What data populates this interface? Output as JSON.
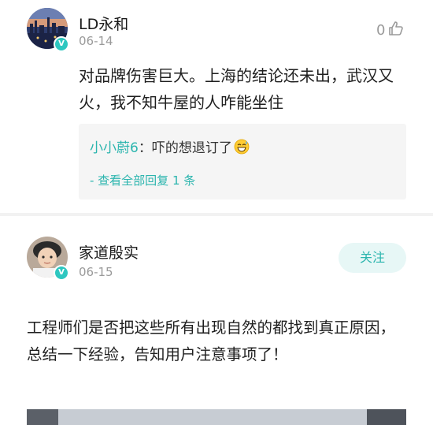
{
  "comments": [
    {
      "username": "LD永和",
      "date": "06-14",
      "verified_badge": "V",
      "text": "对品牌伤害巨大。上海的结论还未出，武汉又火，我不知牛屋的人咋能坐住",
      "likes": "0",
      "reply": {
        "author": "小小蔚6",
        "separator": "：",
        "text": "吓的想退订了",
        "emoji_icon": "grinning-sweat-emoji",
        "view_all": "- 查看全部回复 1 条"
      }
    },
    {
      "username": "家道殷实",
      "date": "06-15",
      "verified_badge": "V",
      "follow_label": "关注",
      "text": "工程师们是否把这些所有出现自然的都找到真正原因，总结一下经验，告知用户注意事项了！"
    }
  ],
  "colors": {
    "accent": "#2bb5ae",
    "badge": "#2ec7c0",
    "follow_bg": "#e7f7f6",
    "reply_bg": "#f5f5f5",
    "meta": "#9a9a9a"
  },
  "icons": {
    "like": "thumbs-up-icon",
    "verified": "verified-badge-icon"
  }
}
